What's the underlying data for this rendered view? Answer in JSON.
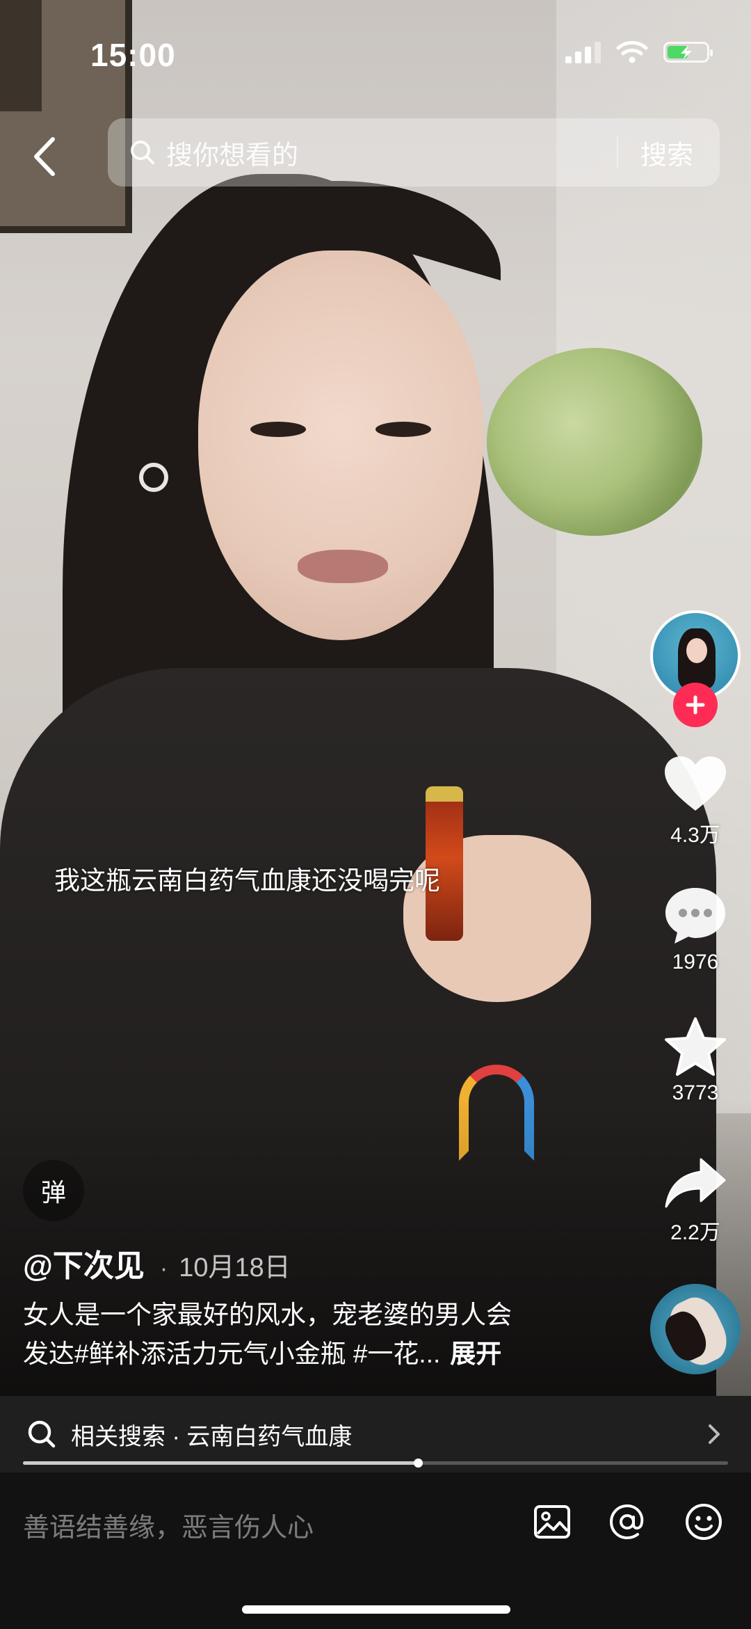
{
  "status_bar": {
    "time": "15:00",
    "battery_level": 0.58
  },
  "search": {
    "placeholder": "搜你想看的",
    "button_label": "搜索"
  },
  "video": {
    "subtitle": "我这瓶云南白药气血康还没喝完呢",
    "progress": 0.56
  },
  "rail": {
    "likes": "4.3万",
    "comments": "1976",
    "favorites": "3773",
    "shares": "2.2万"
  },
  "post": {
    "danmu_label": "弹",
    "author": "@下次见",
    "date": "10月18日",
    "caption_line1": "女人是一个家最好的风水，宠老婆的男人会",
    "caption_line2": "发达#鲜补添活力元气小金瓶 #一花...",
    "expand_label": "展开"
  },
  "related_search": {
    "text": "相关搜索 · 云南白药气血康"
  },
  "comment_bar": {
    "placeholder": "善语结善缘，恶言伤人心"
  },
  "colors": {
    "accent": "#fe2c55",
    "battery_green": "#4cd964"
  }
}
